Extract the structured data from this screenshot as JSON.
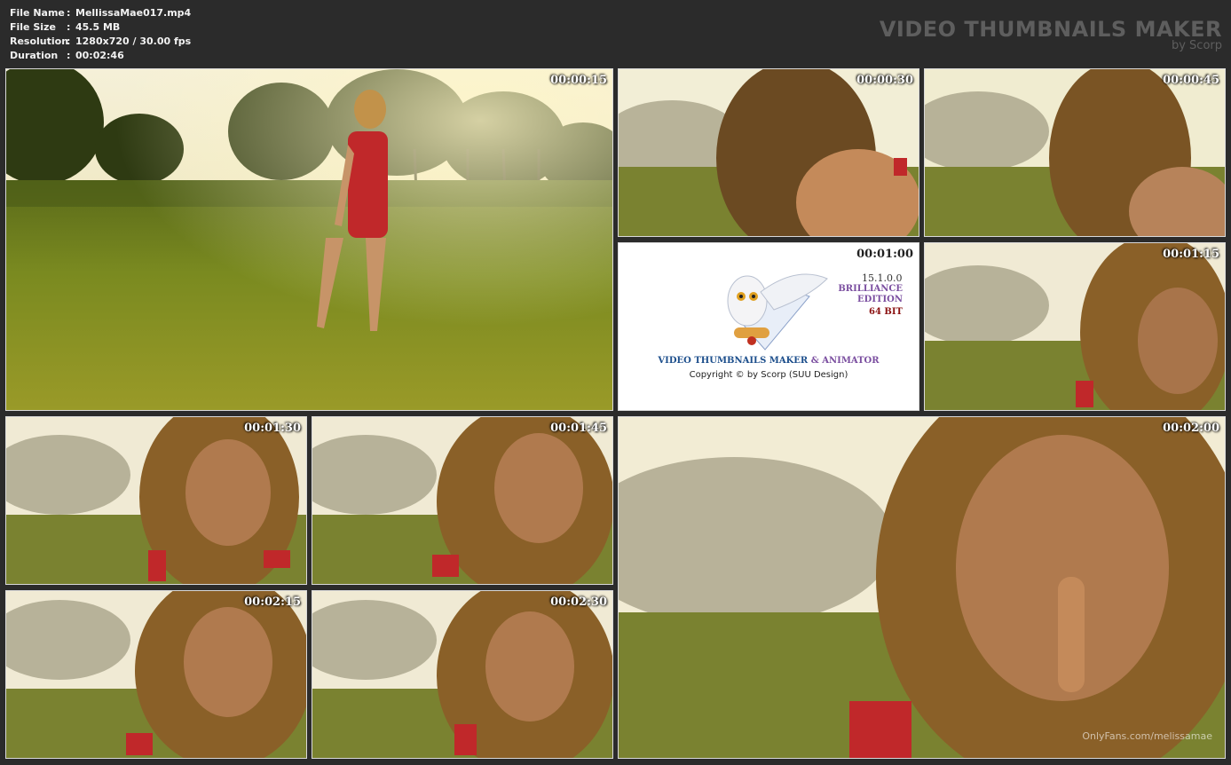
{
  "info": {
    "rows": [
      {
        "label": "File Name",
        "value": "MellissaMae017.mp4"
      },
      {
        "label": "File Size",
        "value": "45.5 MB"
      },
      {
        "label": "Resolution",
        "value": "1280x720 / 30.00 fps"
      },
      {
        "label": "Duration",
        "value": "00:02:46"
      }
    ],
    "separator": ":"
  },
  "brand": {
    "title": "VIDEO THUMBNAILS MAKER",
    "subtitle": "by Scorp"
  },
  "thumbnails": {
    "t1": {
      "time": "00:00:15"
    },
    "t2": {
      "time": "00:00:30"
    },
    "t3": {
      "time": "00:00:45"
    },
    "t4": {
      "time": "00:01:00"
    },
    "t5": {
      "time": "00:01:15"
    },
    "t6": {
      "time": "00:01:30"
    },
    "t7": {
      "time": "00:01:45"
    },
    "t8": {
      "time": "00:02:00",
      "watermark": "OnlyFans.com/melissamae"
    },
    "t9": {
      "time": "00:02:15"
    },
    "t10": {
      "time": "00:02:30"
    }
  },
  "splash": {
    "version": "15.1.0.0",
    "edition_line1": "BRILLIANCE",
    "edition_line2": "EDITION",
    "bits": "64 BIT",
    "title_main": "VIDEO THUMBNAILS MAKER",
    "title_amp": "& ANIMATOR",
    "copyright": "Copyright © by Scorp (SUU Design)"
  },
  "colors": {
    "background": "#2b2b2b",
    "info_text": "#f2f2f2",
    "brand_text": "#5e5e5e",
    "dress_red": "#c0282a"
  }
}
